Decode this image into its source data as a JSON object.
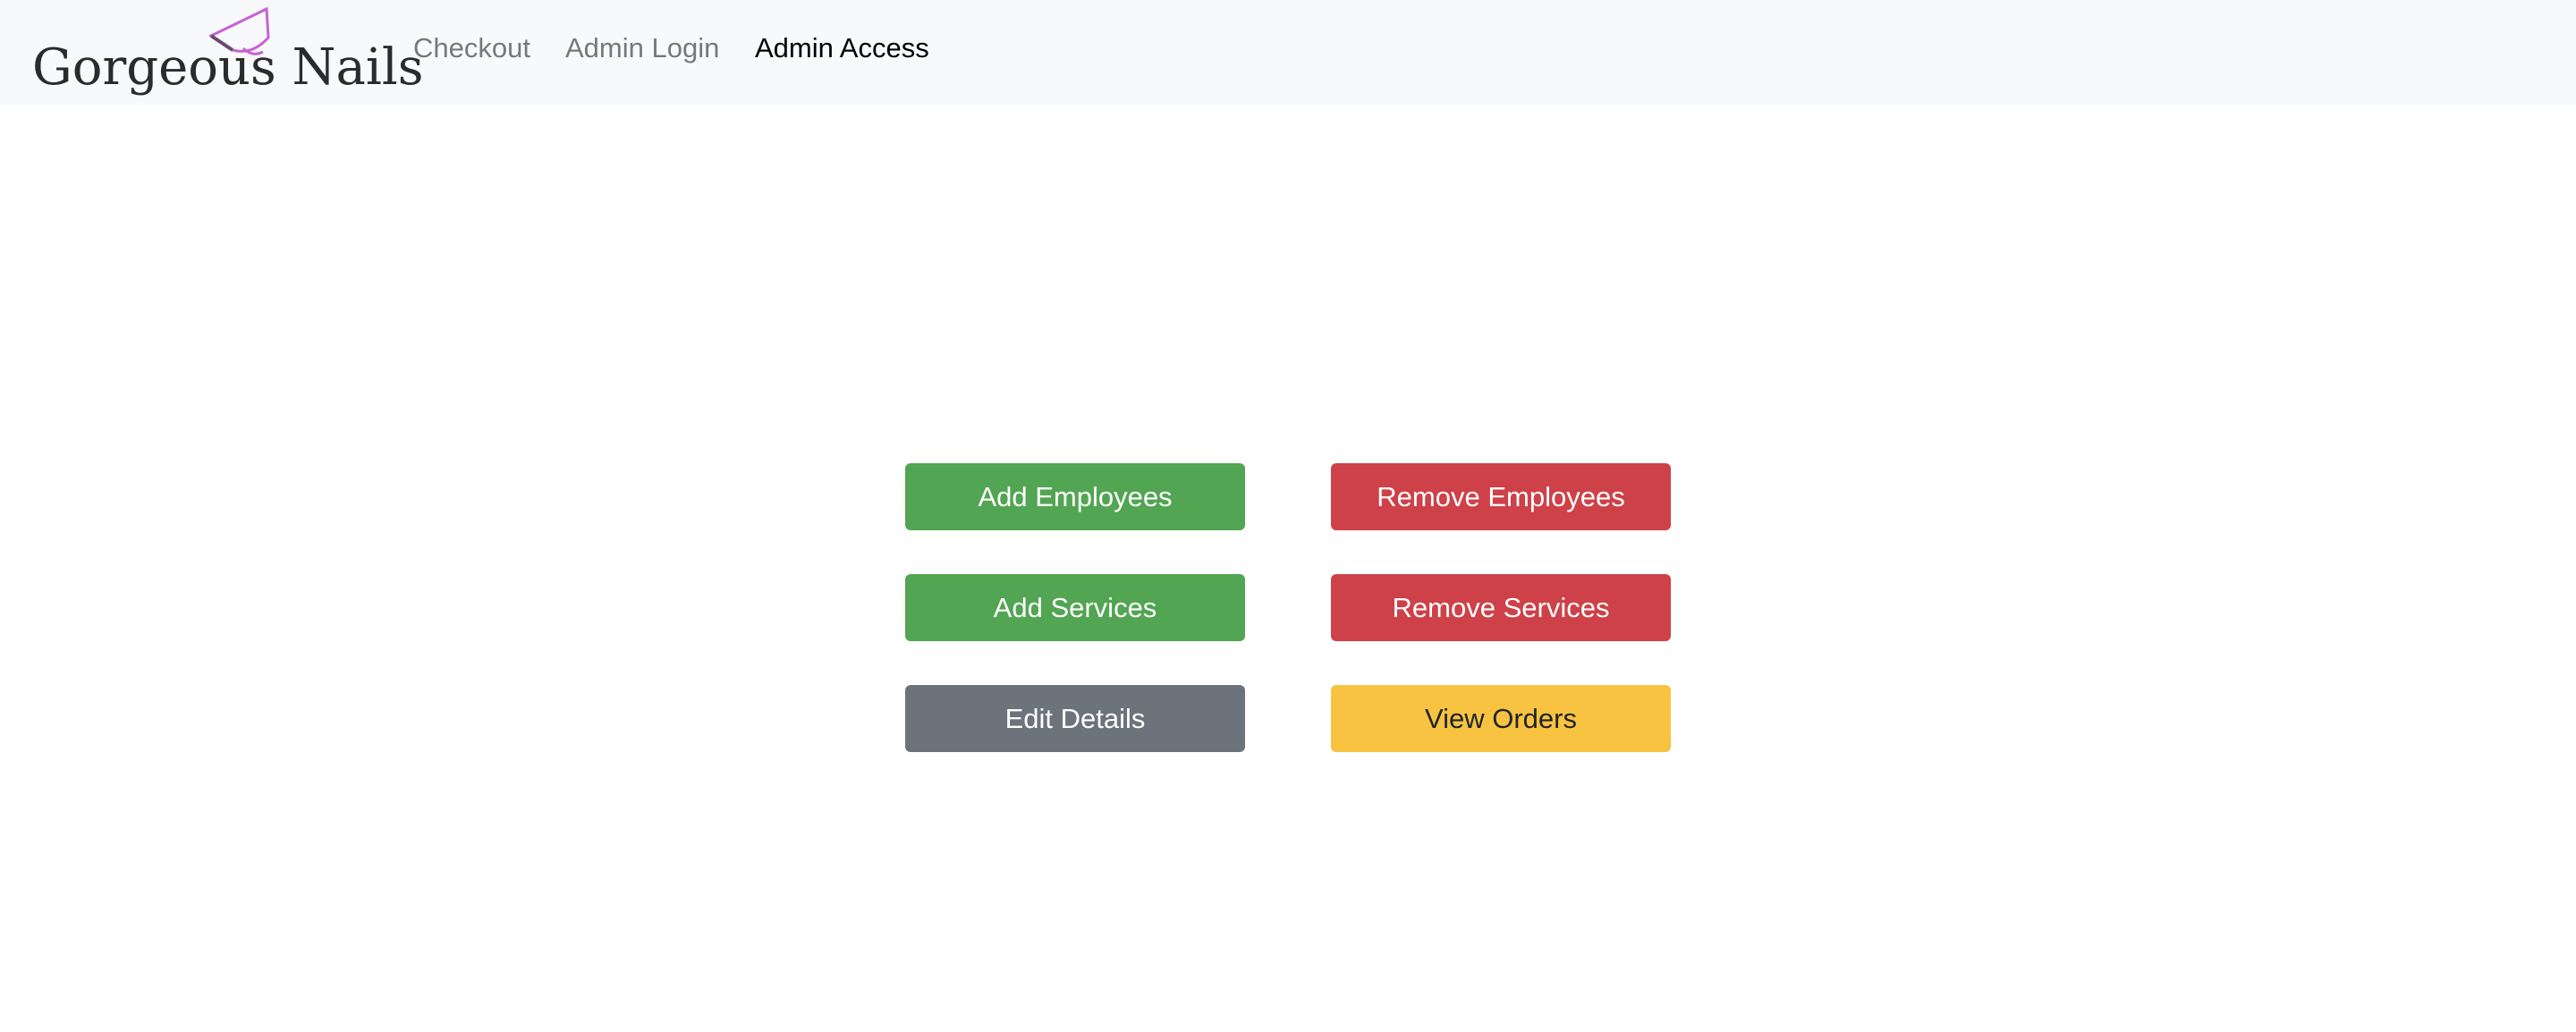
{
  "navbar": {
    "brand": {
      "text": "Gorgeous Nails",
      "logo_icon": "nail-polish-brush-icon",
      "logo_color": "#c762d6"
    },
    "links": [
      {
        "label": "Checkout",
        "active": false
      },
      {
        "label": "Admin Login",
        "active": false
      },
      {
        "label": "Admin Access",
        "active": true
      }
    ],
    "background": "#f8f9fa"
  },
  "actions": {
    "add_employees": {
      "label": "Add Employees",
      "color": "#52a552"
    },
    "remove_employees": {
      "label": "Remove Employees",
      "color": "#ce4149"
    },
    "add_services": {
      "label": "Add Services",
      "color": "#52a552"
    },
    "remove_services": {
      "label": "Remove Services",
      "color": "#ce4149"
    },
    "edit_details": {
      "label": "Edit Details",
      "color": "#6c737b"
    },
    "view_orders": {
      "label": "View Orders",
      "color": "#f7c341"
    }
  }
}
